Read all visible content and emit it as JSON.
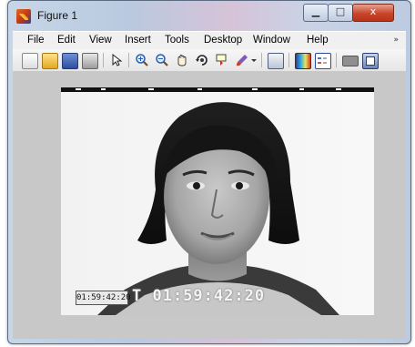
{
  "window": {
    "title": "Figure 1",
    "controls": {
      "minimize": "▁",
      "maximize": "□",
      "close": "x"
    }
  },
  "menubar": {
    "items": [
      "File",
      "Edit",
      "View",
      "Insert",
      "Tools",
      "Desktop",
      "Window",
      "Help"
    ],
    "overflow": "»"
  },
  "toolbar": {
    "icons": [
      "new-figure-icon",
      "open-file-icon",
      "save-icon",
      "print-icon",
      "select-arrow-icon",
      "zoom-in-icon",
      "zoom-out-icon",
      "pan-hand-icon",
      "rotate-3d-icon",
      "data-cursor-icon",
      "brush-icon",
      "link-plot-icon",
      "colorbar-icon",
      "legend-icon",
      "hide-plot-tools-icon",
      "show-plot-tools-icon"
    ]
  },
  "figure": {
    "timecode_small": "01:59:42:20",
    "timecode_large": "T 01:59:42:20"
  },
  "colors": {
    "figure_background": "#c8c8c8",
    "close_button": "#c8452b"
  }
}
